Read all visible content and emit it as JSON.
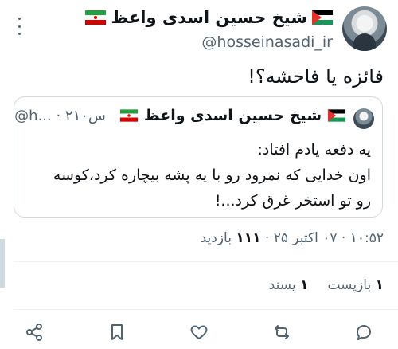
{
  "author": {
    "display_name": "شیخ حسین اسدی واعظ",
    "handle": "@hosseinasadi_ir"
  },
  "tweet": {
    "text": "فائزه یا فاحشه؟!",
    "timestamp_time": "۱۰:۵۲",
    "timestamp_date": "۰۷ اکتبر ۲۵",
    "views_count": "۱۱۱",
    "views_label": "بازدید"
  },
  "quoted": {
    "display_name": "شیخ حسین اسدی واعظ",
    "handle_truncated": "@h...",
    "age": "۲۱۰س",
    "line1": "یه دفعه یادم افتاد:",
    "line2": "اون خدایی که نمرود رو با یه پشه بیچاره کرد،کوسه",
    "line3": "رو تو استخر غرق کرد...!"
  },
  "stats": {
    "reposts_count": "۱",
    "reposts_label": "بازپست",
    "likes_count": "۱",
    "likes_label": "پسند"
  },
  "icons": {
    "more": "more-vertical-icon",
    "reply": "reply-icon",
    "repost": "repost-icon",
    "like": "heart-icon",
    "bookmark": "bookmark-icon",
    "share": "share-icon"
  },
  "colors": {
    "text": "#0f1419",
    "muted": "#536471",
    "border": "#cfd9de"
  }
}
